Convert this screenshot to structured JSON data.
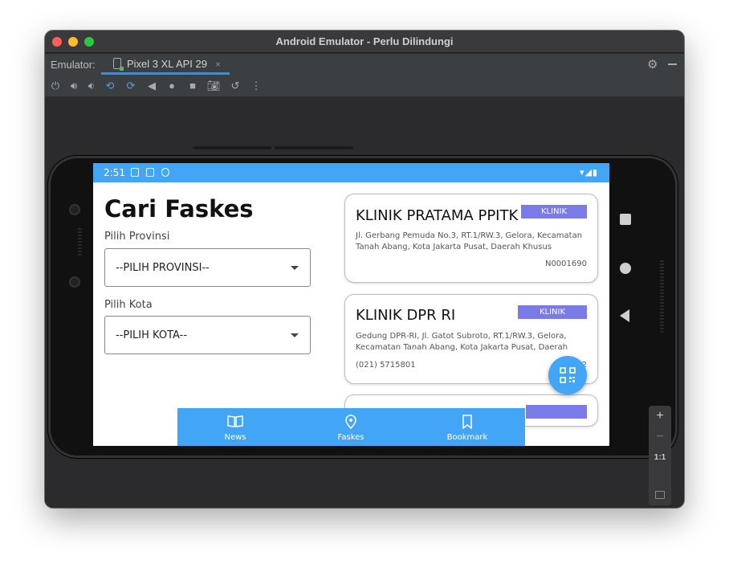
{
  "window": {
    "title": "Android Emulator - Perlu Dilindungi"
  },
  "emulator_bar": {
    "label": "Emulator:",
    "device_tab": "Pixel 3 XL API 29",
    "close_glyph": "×"
  },
  "toolbar": {
    "icons": [
      "power-icon",
      "volume-up-icon",
      "volume-down-icon",
      "rotate-left-icon",
      "rotate-right-icon",
      "back-icon",
      "home-icon",
      "overview-icon",
      "camera-icon",
      "snapshot-icon",
      "more-icon"
    ]
  },
  "zoom": {
    "plus": "+",
    "minus": "−",
    "ratio": "1:1"
  },
  "status_bar": {
    "time": "2:51"
  },
  "app": {
    "title": "Cari Faskes",
    "province_label": "Pilih Provinsi",
    "province_value": "--PILIH PROVINSI--",
    "city_label": "Pilih Kota",
    "city_value": "--PILIH KOTA--"
  },
  "cards": [
    {
      "name": "KLINIK PRATAMA PPITK",
      "badge": "KLINIK",
      "address": "Jl. Gerbang Pemuda No.3, RT.1/RW.3, Gelora, Kecamatan Tanah Abang, Kota Jakarta Pusat, Daerah Khusus",
      "code": "N0001690"
    },
    {
      "name": "KLINIK DPR RI",
      "badge": "KLINIK",
      "address": "Gedung DPR-RI, Jl. Gatot Subroto, RT.1/RW.3, Gelora, Kecamatan Tanah Abang, Kota Jakarta Pusat, Daerah",
      "phone": "(021) 5715801",
      "code": "N...2"
    }
  ],
  "bottom_nav": {
    "items": [
      {
        "label": "News",
        "icon": "book-icon"
      },
      {
        "label": "Faskes",
        "icon": "location-pin-icon"
      },
      {
        "label": "Bookmark",
        "icon": "bookmark-icon"
      }
    ]
  },
  "colors": {
    "primary": "#42a5f5",
    "badge": "#7b7be8",
    "window_chrome": "#3c3f41"
  }
}
